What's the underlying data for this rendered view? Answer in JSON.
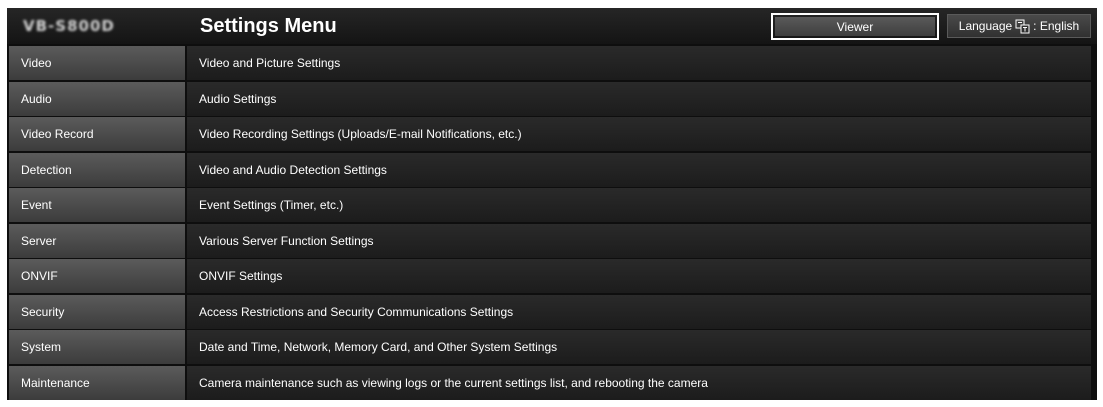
{
  "header": {
    "logo_text": "VB-S800D",
    "title": "Settings Menu",
    "viewer_label": "Viewer",
    "language_label": "Language",
    "language_value": ": English"
  },
  "menu": [
    {
      "name": "Video",
      "description": "Video and Picture Settings"
    },
    {
      "name": "Audio",
      "description": "Audio Settings"
    },
    {
      "name": "Video Record",
      "description": "Video Recording Settings (Uploads/E-mail Notifications, etc.)"
    },
    {
      "name": "Detection",
      "description": "Video and Audio Detection Settings"
    },
    {
      "name": "Event",
      "description": "Event Settings (Timer, etc.)"
    },
    {
      "name": "Server",
      "description": "Various Server Function Settings"
    },
    {
      "name": "ONVIF",
      "description": "ONVIF Settings"
    },
    {
      "name": "Security",
      "description": "Access Restrictions and Security Communications Settings"
    },
    {
      "name": "System",
      "description": "Date and Time, Network, Memory Card, and Other System Settings"
    },
    {
      "name": "Maintenance",
      "description": "Camera maintenance such as viewing logs or the current settings list, and rebooting the camera"
    }
  ],
  "icons": {
    "language": "language-icon"
  },
  "colors": {
    "background": "#0e0e0e",
    "name_cell": "#4b4b4b",
    "desc_cell": "#232323",
    "text": "#ffffff"
  }
}
